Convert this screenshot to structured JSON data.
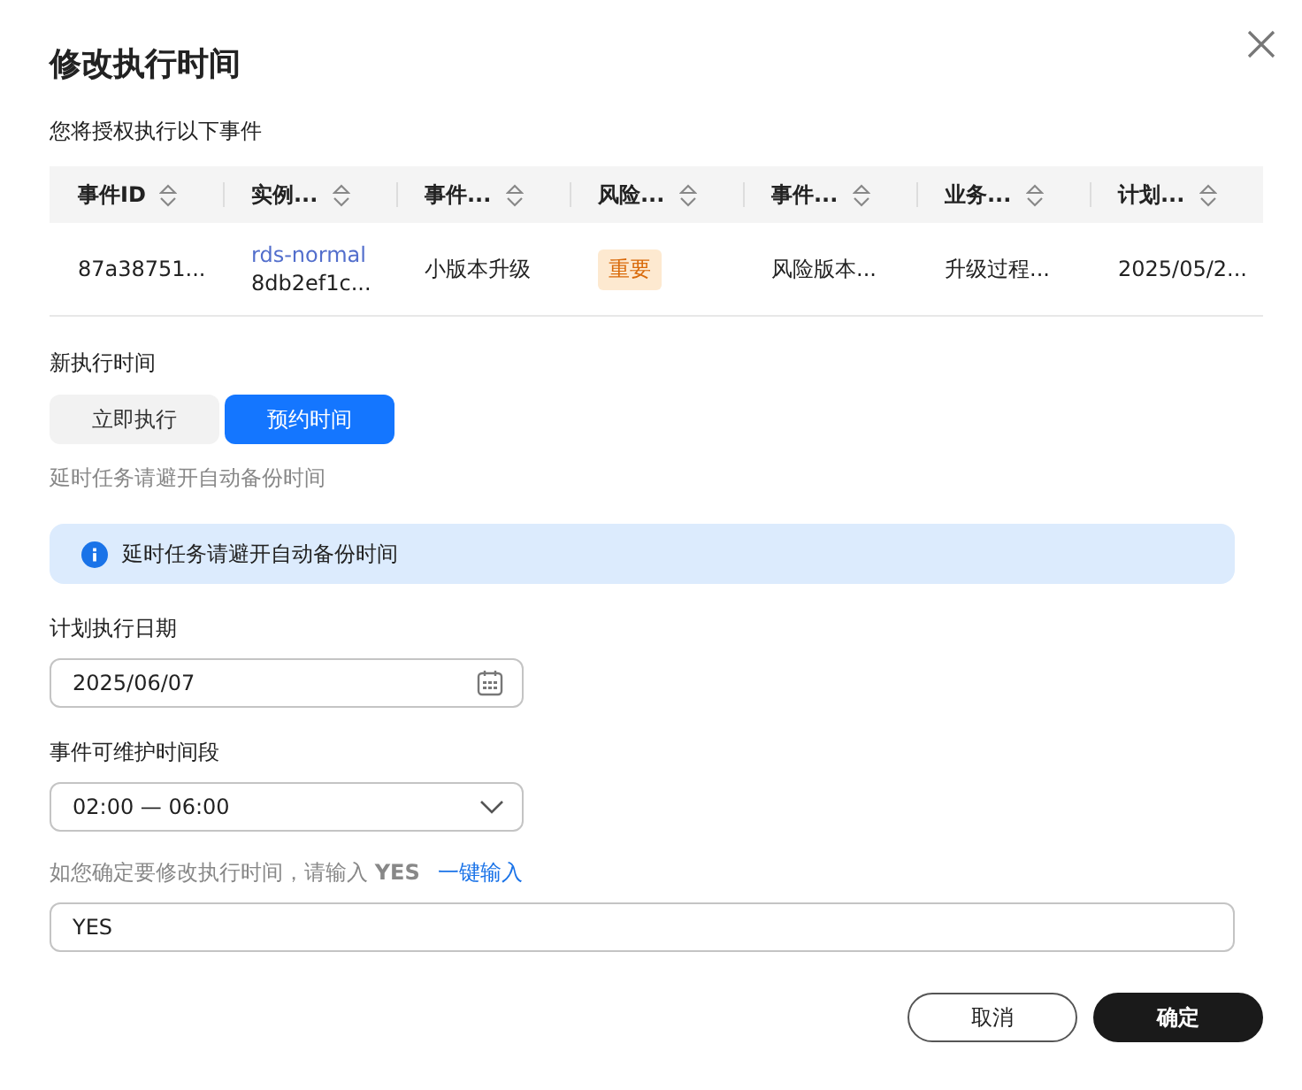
{
  "dialog": {
    "title": "修改执行时间",
    "intro": "您将授权执行以下事件"
  },
  "table": {
    "columns": [
      "事件ID",
      "实例...",
      "事件...",
      "风险...",
      "事件...",
      "业务...",
      "计划..."
    ],
    "rows": [
      {
        "cells": [
          {
            "kind": "text",
            "text": "87a38751..."
          },
          {
            "kind": "link",
            "link": "rds-normal",
            "text": "8db2ef1c..."
          },
          {
            "kind": "text",
            "text": "小版本升级"
          },
          {
            "kind": "tag",
            "text": "重要"
          },
          {
            "kind": "text",
            "text": "风险版本..."
          },
          {
            "kind": "text",
            "text": "升级过程..."
          },
          {
            "kind": "text",
            "text": "2025/05/2..."
          }
        ]
      }
    ]
  },
  "new_time": {
    "label": "新执行时间",
    "options": [
      {
        "label": "立即执行",
        "selected": false
      },
      {
        "label": "预约时间",
        "selected": true
      }
    ],
    "hint": "延时任务请避开自动备份时间"
  },
  "notice": "延时任务请避开自动备份时间",
  "date": {
    "label": "计划执行日期",
    "value": "2025/06/07"
  },
  "window": {
    "label": "事件可维护时间段",
    "value": "02:00 — 06:00"
  },
  "confirm": {
    "prompt": "如您确定要修改执行时间，请输入 **YES**",
    "link": "一键输入",
    "value": "YES"
  },
  "buttons": [
    "取消",
    "确定"
  ]
}
